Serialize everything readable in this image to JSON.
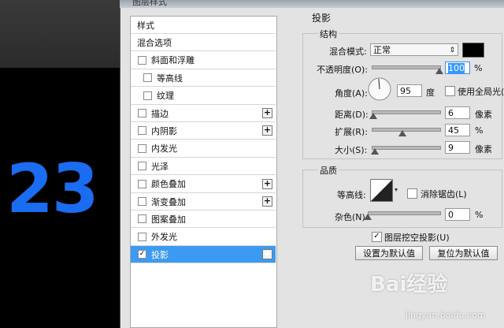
{
  "window": {
    "title": "图层样式"
  },
  "overlay_number": "23",
  "style_list": [
    {
      "label": "样式",
      "checkbox": false,
      "plus": false,
      "checked": false,
      "selected": false
    },
    {
      "label": "混合选项",
      "checkbox": false,
      "plus": false,
      "checked": false,
      "selected": false
    },
    {
      "label": "斜面和浮雕",
      "checkbox": true,
      "plus": false,
      "checked": false,
      "selected": false
    },
    {
      "label": "等高线",
      "checkbox": true,
      "plus": false,
      "checked": false,
      "selected": false,
      "indent": true
    },
    {
      "label": "纹理",
      "checkbox": true,
      "plus": false,
      "checked": false,
      "selected": false,
      "indent": true
    },
    {
      "label": "描边",
      "checkbox": true,
      "plus": true,
      "checked": false,
      "selected": false
    },
    {
      "label": "内阴影",
      "checkbox": true,
      "plus": true,
      "checked": false,
      "selected": false
    },
    {
      "label": "内发光",
      "checkbox": true,
      "plus": false,
      "checked": false,
      "selected": false
    },
    {
      "label": "光泽",
      "checkbox": true,
      "plus": false,
      "checked": false,
      "selected": false
    },
    {
      "label": "颜色叠加",
      "checkbox": true,
      "plus": true,
      "checked": false,
      "selected": false
    },
    {
      "label": "渐变叠加",
      "checkbox": true,
      "plus": true,
      "checked": false,
      "selected": false
    },
    {
      "label": "图案叠加",
      "checkbox": true,
      "plus": false,
      "checked": false,
      "selected": false
    },
    {
      "label": "外发光",
      "checkbox": true,
      "plus": false,
      "checked": false,
      "selected": false
    },
    {
      "label": "投影",
      "checkbox": true,
      "plus": true,
      "checked": true,
      "selected": true
    }
  ],
  "panel": {
    "section_title": "投影",
    "structure": {
      "title": "结构",
      "blend_mode_label": "混合模式:",
      "blend_mode_value": "正常",
      "shadow_color": "#000000",
      "opacity_label": "不透明度(O):",
      "opacity_value": "100",
      "opacity_unit": "%",
      "opacity_level": 1.0,
      "angle_label": "角度(A):",
      "angle_value": "95",
      "angle_unit": "度",
      "global_light_label": "使用全局光(G)",
      "global_light_checked": false,
      "distance_label": "距离(D):",
      "distance_value": "6",
      "distance_unit": "像素",
      "distance_level": 0.02,
      "spread_label": "扩展(R):",
      "spread_value": "45",
      "spread_unit": "%",
      "spread_level": 0.45,
      "size_label": "大小(S):",
      "size_value": "9",
      "size_unit": "像素",
      "size_level": 0.05
    },
    "quality": {
      "title": "品质",
      "contour_label": "等高线:",
      "antialias_label": "消除锯齿(L)",
      "antialias_checked": false,
      "noise_label": "杂色(N):",
      "noise_value": "0",
      "noise_unit": "%",
      "noise_level": 0.0
    },
    "knockout_label": "图层挖空投影(U)",
    "knockout_checked": true,
    "set_default_label": "设置为默认值",
    "reset_default_label": "复位为默认值"
  },
  "watermark": {
    "text": "Bai经验",
    "url": "jingyan.baidu.com"
  }
}
